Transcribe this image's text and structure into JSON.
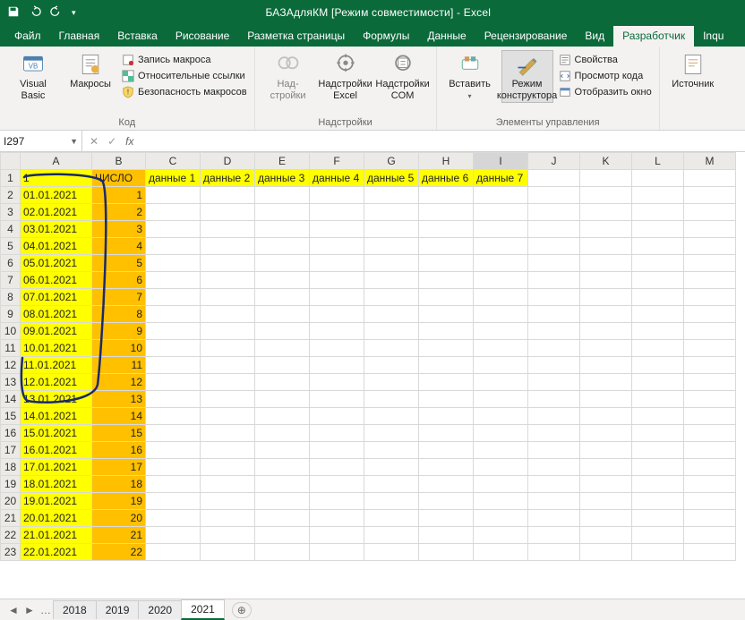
{
  "app": {
    "title": "БАЗАдляКМ  [Режим совместимости]  -  Excel"
  },
  "tabs": {
    "file": "Файл",
    "home": "Главная",
    "insert": "Вставка",
    "draw": "Рисование",
    "layout": "Разметка страницы",
    "formulas": "Формулы",
    "data": "Данные",
    "review": "Рецензирование",
    "view": "Вид",
    "developer": "Разработчик",
    "inquire": "Inqu"
  },
  "ribbon": {
    "code": {
      "visual_basic": "Visual\nBasic",
      "macros": "Макросы",
      "record": "Запись макроса",
      "relative": "Относительные ссылки",
      "security": "Безопасность макросов",
      "label": "Код"
    },
    "addins": {
      "addins": "Над-\nстройки",
      "excel_addins": "Надстройки\nExcel",
      "com_addins": "Надстройки\nCOM",
      "label": "Надстройки"
    },
    "controls": {
      "insert": "Вставить",
      "design": "Режим\nконструктора",
      "properties": "Свойства",
      "view_code": "Просмотр кода",
      "run_dialog": "Отобразить окно",
      "label": "Элементы управления"
    },
    "xml": {
      "source": "Источник"
    }
  },
  "namebox": "I297",
  "headers": [
    "A",
    "B",
    "C",
    "D",
    "E",
    "F",
    "G",
    "H",
    "I",
    "J",
    "K",
    "L",
    "M"
  ],
  "row1": {
    "A": "1",
    "B": "ЧИСЛО",
    "C": "данные 1",
    "D": "данные 2",
    "E": "данные 3",
    "F": "данные 4",
    "G": "данные 5",
    "H": "данные 6",
    "I": "данные 7"
  },
  "rows": [
    {
      "n": 2,
      "A": "01.01.2021",
      "B": "1"
    },
    {
      "n": 3,
      "A": "02.01.2021",
      "B": "2"
    },
    {
      "n": 4,
      "A": "03.01.2021",
      "B": "3"
    },
    {
      "n": 5,
      "A": "04.01.2021",
      "B": "4"
    },
    {
      "n": 6,
      "A": "05.01.2021",
      "B": "5"
    },
    {
      "n": 7,
      "A": "06.01.2021",
      "B": "6"
    },
    {
      "n": 8,
      "A": "07.01.2021",
      "B": "7"
    },
    {
      "n": 9,
      "A": "08.01.2021",
      "B": "8"
    },
    {
      "n": 10,
      "A": "09.01.2021",
      "B": "9"
    },
    {
      "n": 11,
      "A": "10.01.2021",
      "B": "10"
    },
    {
      "n": 12,
      "A": "11.01.2021",
      "B": "11"
    },
    {
      "n": 13,
      "A": "12.01.2021",
      "B": "12"
    },
    {
      "n": 14,
      "A": "13.01.2021",
      "B": "13"
    },
    {
      "n": 15,
      "A": "14.01.2021",
      "B": "14"
    },
    {
      "n": 16,
      "A": "15.01.2021",
      "B": "15"
    },
    {
      "n": 17,
      "A": "16.01.2021",
      "B": "16"
    },
    {
      "n": 18,
      "A": "17.01.2021",
      "B": "17"
    },
    {
      "n": 19,
      "A": "18.01.2021",
      "B": "18"
    },
    {
      "n": 20,
      "A": "19.01.2021",
      "B": "19"
    },
    {
      "n": 21,
      "A": "20.01.2021",
      "B": "20"
    },
    {
      "n": 22,
      "A": "21.01.2021",
      "B": "21"
    },
    {
      "n": 23,
      "A": "22.01.2021",
      "B": "22"
    }
  ],
  "sheets": {
    "dots": "…",
    "s1": "2018",
    "s2": "2019",
    "s3": "2020",
    "s4": "2021"
  }
}
